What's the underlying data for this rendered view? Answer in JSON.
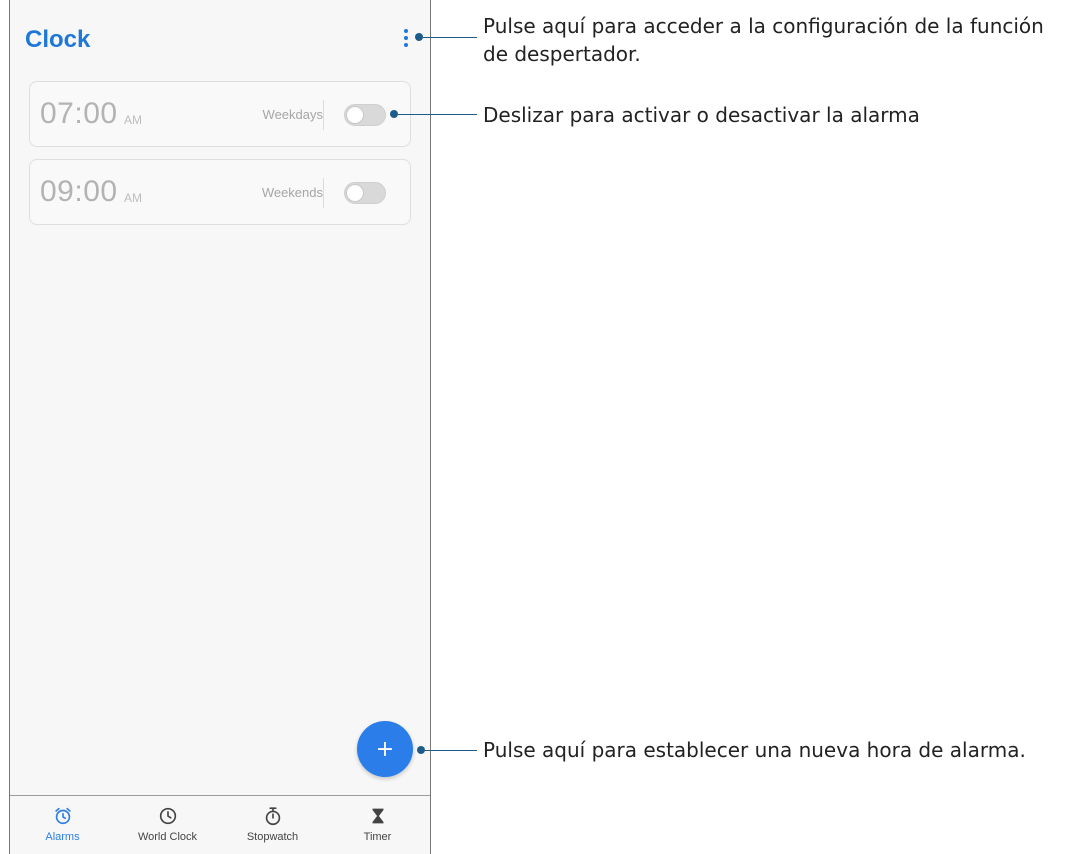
{
  "app": {
    "title": "Clock"
  },
  "alarms": [
    {
      "time": "07:00",
      "ampm": "AM",
      "repeat": "Weekdays",
      "enabled": false
    },
    {
      "time": "09:00",
      "ampm": "AM",
      "repeat": "Weekends",
      "enabled": false
    }
  ],
  "fab": {
    "label": "+"
  },
  "nav": [
    {
      "label": "Alarms",
      "icon": "alarm-clock-icon",
      "active": true
    },
    {
      "label": "World Clock",
      "icon": "clock-icon",
      "active": false
    },
    {
      "label": "Stopwatch",
      "icon": "stopwatch-icon",
      "active": false
    },
    {
      "label": "Timer",
      "icon": "hourglass-icon",
      "active": false
    }
  ],
  "callouts": {
    "menu": "Pulse aquí para acceder a la configuración de la función de despertador.",
    "toggle": "Deslizar para activar o desactivar la alarma",
    "add": "Pulse aquí para establecer una nueva hora de alarma."
  },
  "colors": {
    "accent": "#2b7de9",
    "title": "#1e78d7",
    "callout": "#1d5c8a"
  }
}
